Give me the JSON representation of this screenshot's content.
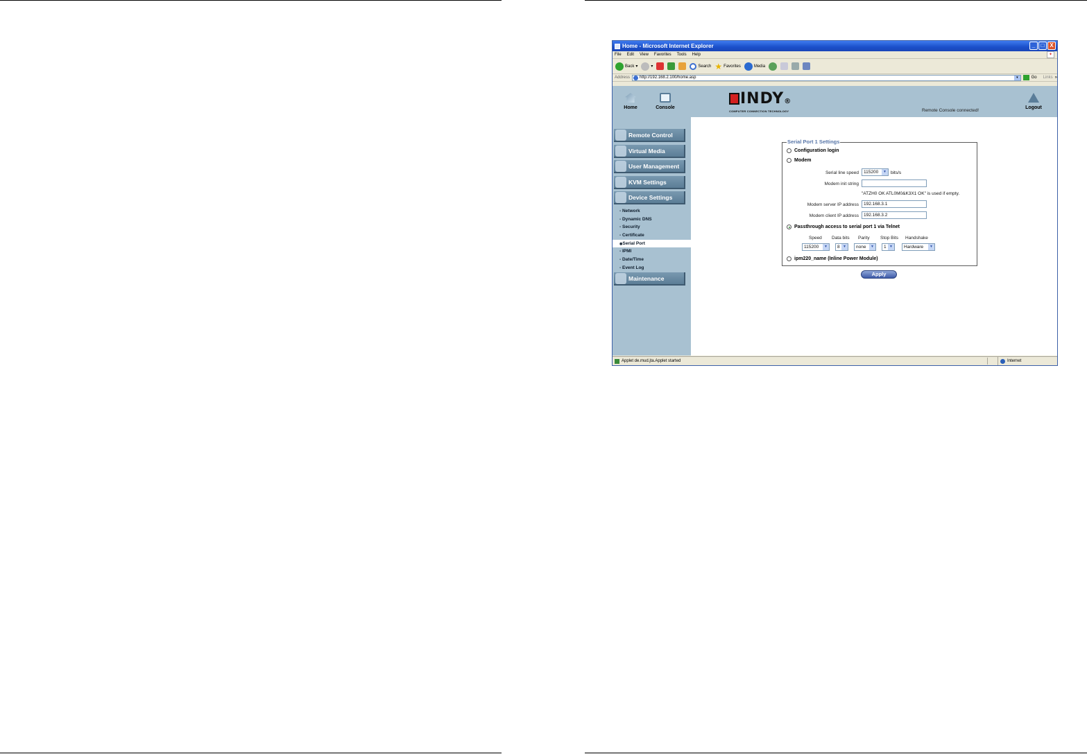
{
  "window": {
    "title": "Home - Microsoft Internet Explorer",
    "controls": [
      "_",
      "□",
      "X"
    ]
  },
  "menu": [
    "File",
    "Edit",
    "View",
    "Favorites",
    "Tools",
    "Help"
  ],
  "toolbar": {
    "back": "Back",
    "search": "Search",
    "favorites": "Favorites",
    "media": "Media"
  },
  "address": {
    "label": "Address",
    "url": "http://192.168.2.100/home.asp",
    "go": "Go",
    "links": "Links",
    "more": "»"
  },
  "header": {
    "home": "Home",
    "console": "Console",
    "logout": "Logout",
    "brand": "INDY",
    "brand_mark": "®",
    "brand_tagline": "COMPUTER CONNECTION TECHNOLOGY",
    "status": "Remote Console connected!"
  },
  "nav": {
    "remote_control": "Remote Control",
    "virtual_media": "Virtual Media",
    "user_management": "User Management",
    "kvm_settings": "KVM Settings",
    "device_settings": "Device Settings",
    "maintenance": "Maintenance",
    "device_items": [
      "Network",
      "Dynamic DNS",
      "Security",
      "Certificate",
      "Serial Port",
      "IPMI",
      "Date/Time",
      "Event Log"
    ],
    "active_item": "Serial Port"
  },
  "form": {
    "legend": "Serial Port 1 Settings",
    "option_config": "Configuration login",
    "option_modem": "Modem",
    "option_passthrough": "Passthrough access to serial port 1 via Telnet",
    "option_ipm": "ipm220_name (Inline Power Module)",
    "selected_option": "Passthrough access to serial port 1 via Telnet",
    "serial_speed_label": "Serial line speed",
    "serial_speed_value": "115200",
    "serial_speed_unit": "bits/s",
    "init_string_label": "Modem init string",
    "init_string_value": "",
    "init_string_note": "\"ATZH0 OK ATL0M0&K3X1 OK\" is used if empty.",
    "server_ip_label": "Modem server IP address",
    "server_ip_value": "192.168.3.1",
    "client_ip_label": "Modem client IP address",
    "client_ip_value": "192.168.3.2",
    "columns": [
      "Speed",
      "Data bits",
      "Parity",
      "Stop Bits",
      "Handshake"
    ],
    "speed": "115200",
    "data_bits": "8",
    "parity": "none",
    "stop_bits": "1",
    "handshake": "Hardware",
    "apply": "Apply"
  },
  "statusbar": {
    "text": "Applet de.mud.jta.Applet started",
    "zone": "Internet"
  }
}
